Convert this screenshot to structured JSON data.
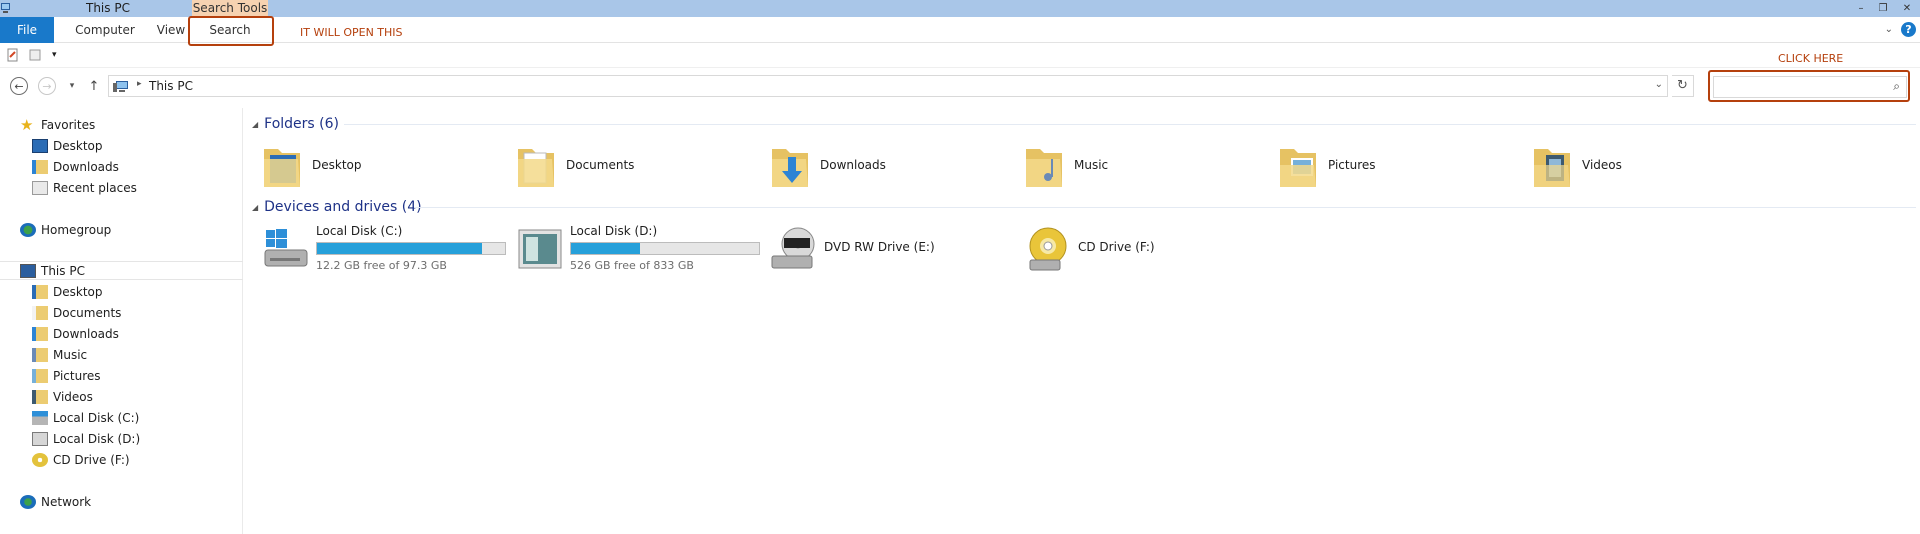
{
  "window": {
    "title": "This PC",
    "context_tab": "Search Tools"
  },
  "ribbon": {
    "tabs": [
      "File",
      "Computer",
      "View",
      "Search"
    ]
  },
  "annotations": {
    "search_tab_note": "IT WILL OPEN THIS",
    "search_box_note": "CLICK HERE"
  },
  "address": {
    "breadcrumb": "This PC",
    "search_placeholder": ""
  },
  "nav": {
    "favorites": "Favorites",
    "favorites_items": [
      "Desktop",
      "Downloads",
      "Recent places"
    ],
    "homegroup": "Homegroup",
    "this_pc": "This PC",
    "this_pc_items": [
      "Desktop",
      "Documents",
      "Downloads",
      "Music",
      "Pictures",
      "Videos",
      "Local Disk (C:)",
      "Local Disk (D:)",
      "CD Drive (F:)"
    ],
    "network": "Network"
  },
  "folders": {
    "header": "Folders (6)",
    "items": [
      "Desktop",
      "Documents",
      "Downloads",
      "Music",
      "Pictures",
      "Videos"
    ]
  },
  "devices": {
    "header": "Devices and drives (4)",
    "items": [
      {
        "name": "Local Disk (C:)",
        "free": "12.2 GB free of 97.3 GB",
        "used_fraction": 0.875
      },
      {
        "name": "Local Disk (D:)",
        "free": "526 GB free of 833 GB",
        "used_fraction": 0.368
      },
      {
        "name": "DVD RW Drive (E:)"
      },
      {
        "name": "CD Drive (F:)"
      }
    ]
  },
  "colors": {
    "accent": "#1979ca",
    "annotation": "#b5400d",
    "context_tab": "#f6d2b1",
    "drive_bar": "#26a0da"
  }
}
